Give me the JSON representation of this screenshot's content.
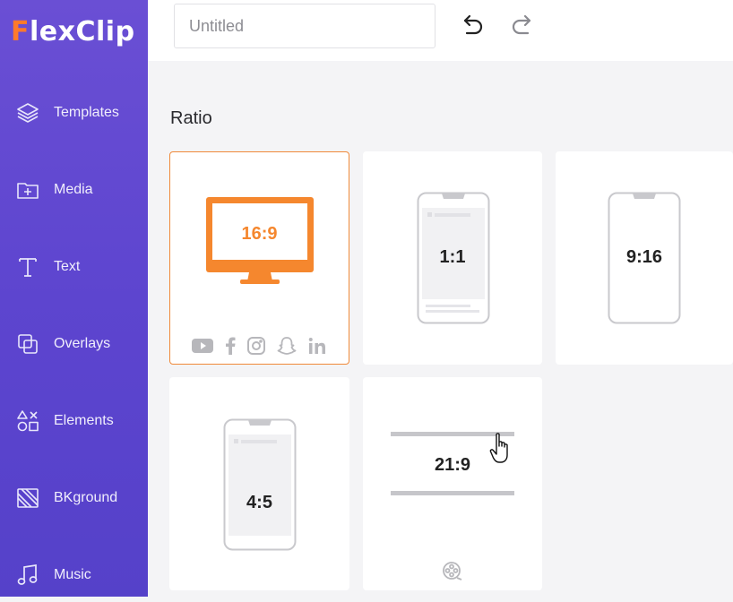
{
  "app": {
    "logo_first": "F",
    "logo_rest": "lexClip"
  },
  "sidebar": {
    "items": [
      {
        "label": "Templates",
        "icon": "layers-icon"
      },
      {
        "label": "Media",
        "icon": "folder-plus-icon"
      },
      {
        "label": "Text",
        "icon": "text-icon"
      },
      {
        "label": "Overlays",
        "icon": "overlays-icon"
      },
      {
        "label": "Elements",
        "icon": "shapes-icon"
      },
      {
        "label": "BKground",
        "icon": "background-icon"
      },
      {
        "label": "Music",
        "icon": "music-icon"
      }
    ]
  },
  "header": {
    "title_value": "",
    "title_placeholder": "Untitled"
  },
  "main": {
    "section_title": "Ratio",
    "ratios": [
      {
        "label": "16:9",
        "selected": true
      },
      {
        "label": "1:1",
        "selected": false
      },
      {
        "label": "9:16",
        "selected": false
      },
      {
        "label": "4:5",
        "selected": false
      },
      {
        "label": "21:9",
        "selected": false
      }
    ]
  },
  "colors": {
    "accent": "#f08a3a",
    "sidebar": "#5d45cf"
  }
}
